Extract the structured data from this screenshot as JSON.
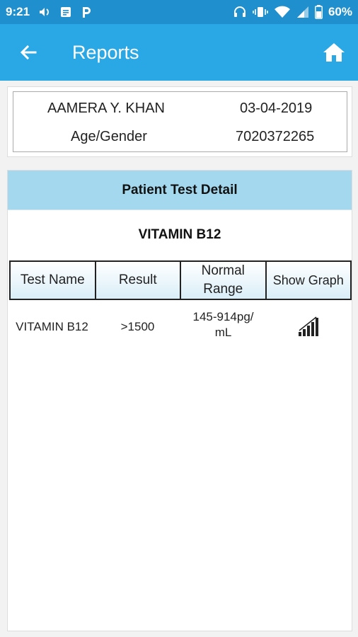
{
  "status_bar": {
    "time": "9:21",
    "battery_percent": "60%",
    "left_icons": [
      "volume-icon",
      "message-icon",
      "paytm-icon"
    ],
    "right_icons": [
      "headset-icon",
      "vibrate-icon",
      "wifi-icon",
      "signal-icon",
      "battery-icon"
    ]
  },
  "app_bar": {
    "title": "Reports",
    "back_icon": "arrow-left-icon",
    "home_icon": "home-icon",
    "color": "#2aa7e5"
  },
  "patient": {
    "name": "AAMERA Y. KHAN",
    "date": "03-04-2019",
    "age_gender_label": "Age/Gender",
    "phone": "7020372265"
  },
  "detail": {
    "header": "Patient Test Detail",
    "test_group": "VITAMIN B12",
    "header_color": "#a3d8ee",
    "columns": [
      "Test Name",
      "Result",
      "Normal Range",
      "Show Graph"
    ],
    "rows": [
      {
        "test_name": "VITAMIN B12",
        "result": ">1500",
        "normal_range": "145-914pg/ mL",
        "graph_icon": "bar-graph-icon"
      }
    ]
  }
}
